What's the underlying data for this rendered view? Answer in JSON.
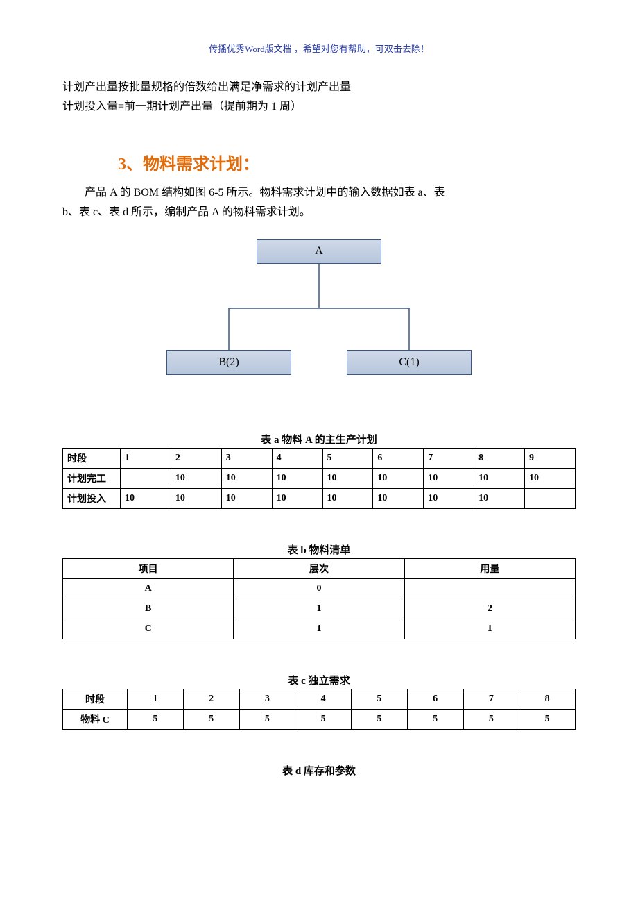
{
  "header_note": "传播优秀Word版文档 ，希望对您有帮助，可双击去除！",
  "intro_line1": "计划产出量按批量规格的倍数给出满足净需求的计划产出量",
  "intro_line2": "计划投入量=前一期计划产出量（提前期为 1 周）",
  "section_heading": "3、物料需求计划：",
  "para1": "产品 A 的 BOM 结构如图 6-5 所示。物料需求计划中的输入数据如表 a、表",
  "para2": "b、表 c、表 d 所示，编制产品 A 的物料需求计划。",
  "bom": {
    "root": "A",
    "child_left": "B(2)",
    "child_right": "C(1)"
  },
  "table_a": {
    "caption": "表 a    物料 A 的主生产计划",
    "rows": [
      [
        "时段",
        "1",
        "2",
        "3",
        "4",
        "5",
        "6",
        "7",
        "8",
        "9"
      ],
      [
        "计划完工",
        "",
        "10",
        "10",
        "10",
        "10",
        "10",
        "10",
        "10",
        "10"
      ],
      [
        "计划投入",
        "10",
        "10",
        "10",
        "10",
        "10",
        "10",
        "10",
        "10",
        ""
      ]
    ]
  },
  "table_b": {
    "caption": "表 b    物料清单",
    "rows": [
      [
        "项目",
        "层次",
        "用量"
      ],
      [
        "A",
        "0",
        ""
      ],
      [
        "B",
        "1",
        "2"
      ],
      [
        "C",
        "1",
        "1"
      ]
    ]
  },
  "table_c": {
    "caption": "表 c    独立需求",
    "rows": [
      [
        "时段",
        "1",
        "2",
        "3",
        "4",
        "5",
        "6",
        "7",
        "8"
      ],
      [
        "物料 C",
        "5",
        "5",
        "5",
        "5",
        "5",
        "5",
        "5",
        "5"
      ]
    ]
  },
  "table_d": {
    "caption": "表 d    库存和参数"
  }
}
